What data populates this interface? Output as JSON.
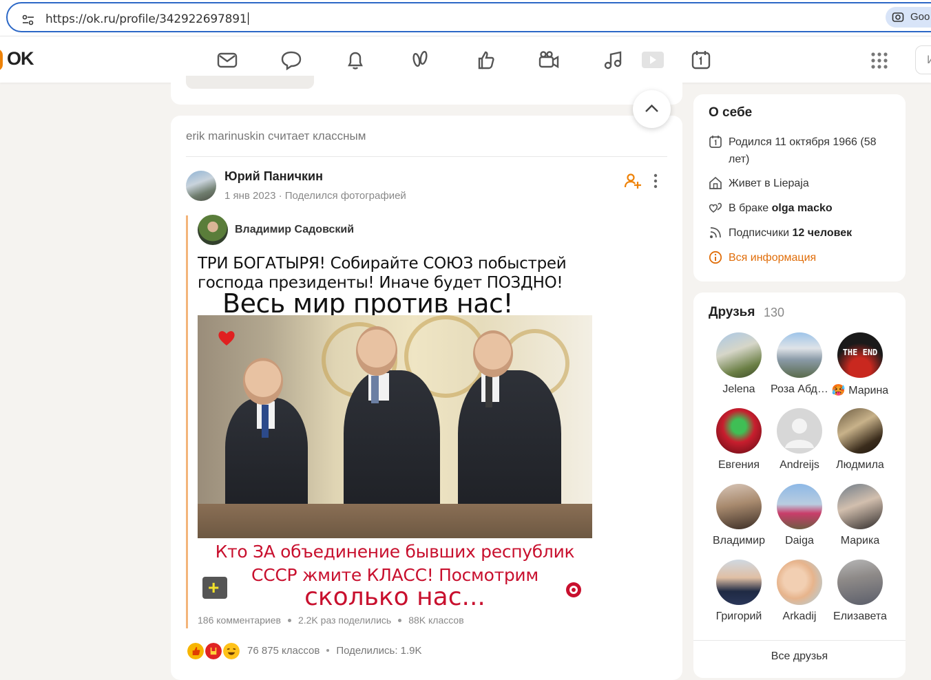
{
  "browser": {
    "url": "https://ok.ru/profile/342922697891",
    "side_button_label": "Goo"
  },
  "topbar": {
    "logo": "OK",
    "search_placeholder": "И"
  },
  "feed": {
    "activity": "erik marinuskin считает классным",
    "author_name": "Юрий Паничкин",
    "author_meta": "1 янв 2023 · Поделился фотографией",
    "reshared_from": "Владимир Садовский",
    "image_text": {
      "line1": "ТРИ БОГАТЫРЯ! Собирайте СОЮЗ побыстрей господа президенты! Иначе будет ПОЗДНО!",
      "line2": "Весь мир против нас!",
      "line3": "Кто ЗА объединение бывших республик СССР жмите КЛАСС! Посмотрим",
      "line4": "сколько нас..."
    },
    "stats": {
      "comments": "186 комментариев",
      "shares": "2.2K раз поделились",
      "likes": "88K классов"
    },
    "reactions_count": "76 875 классов",
    "shared_count": "Поделились: 1.9K"
  },
  "about": {
    "title": "О себе",
    "birth": "Родился 11 октября 1966 (58 лет)",
    "lives_prefix": "Живет в ",
    "lives_city": "Liepaja",
    "married_prefix": "В браке ",
    "married_to": "olga macko",
    "subs_prefix": "Подписчики ",
    "subs_count": "12 человек",
    "all_info": "Вся информация"
  },
  "friends": {
    "title": "Друзья",
    "count": "130",
    "items": [
      {
        "name": "Jelena"
      },
      {
        "name": "Роза Абдулаева"
      },
      {
        "name": "🥵 Марина"
      },
      {
        "name": "Евгения"
      },
      {
        "name": "Andreijs"
      },
      {
        "name": "Людмила"
      },
      {
        "name": "Владимир"
      },
      {
        "name": "Daiga"
      },
      {
        "name": "Марика"
      },
      {
        "name": "Григорий"
      },
      {
        "name": "Arkadij"
      },
      {
        "name": "Елизавета"
      }
    ],
    "avatar_text_3": "THE END",
    "all_friends": "Все друзья"
  },
  "colors": {
    "brand": "#ee8208",
    "accent_link": "#e06d09",
    "address_border": "#2b67c6"
  }
}
